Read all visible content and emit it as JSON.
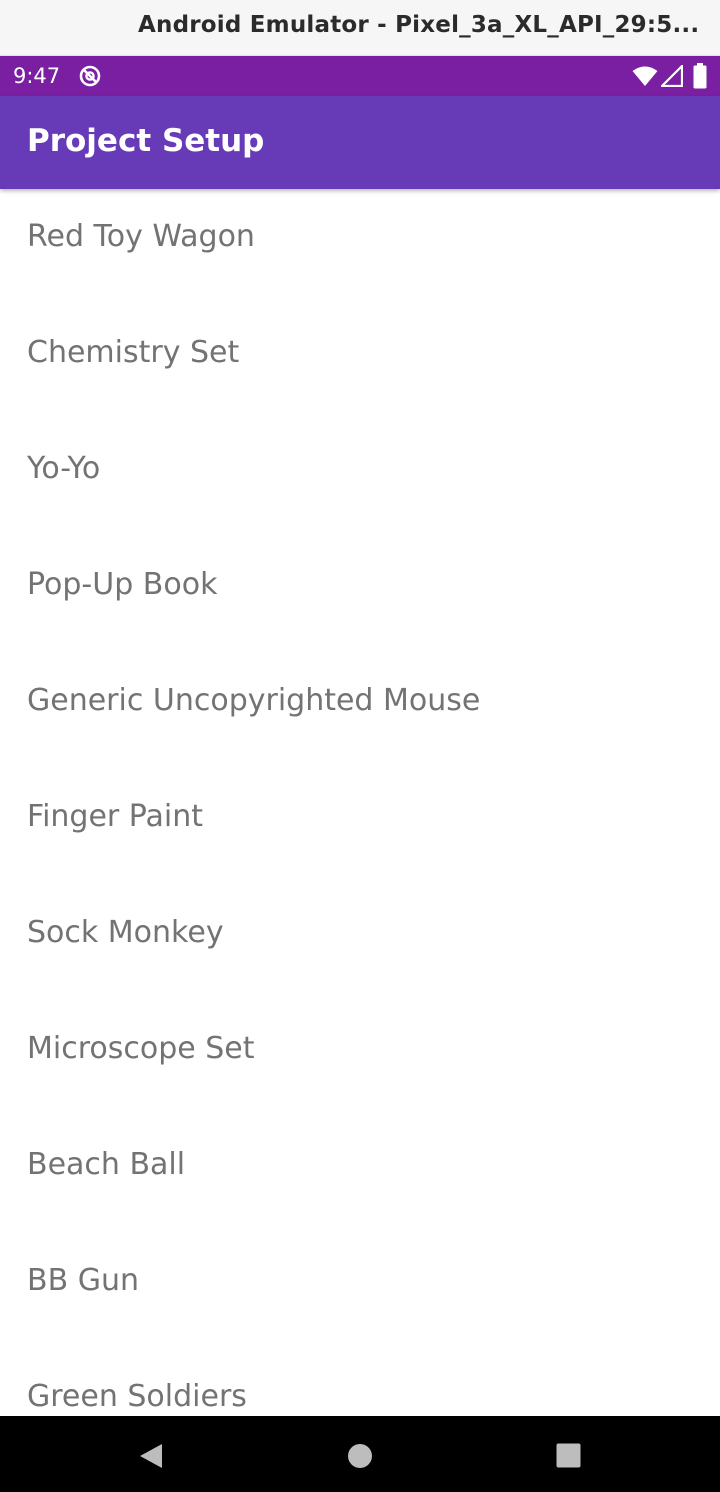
{
  "window": {
    "title": "Android Emulator - Pixel_3a_XL_API_29:5..."
  },
  "status_bar": {
    "time": "9:47",
    "color": "#7b1fa2",
    "icons": [
      "sync-icon",
      "wifi-icon",
      "cellular-signal-icon",
      "battery-icon"
    ]
  },
  "app_bar": {
    "title": "Project Setup",
    "color": "#673ab7"
  },
  "list": {
    "items": [
      {
        "label": "Red Toy Wagon"
      },
      {
        "label": "Chemistry Set"
      },
      {
        "label": "Yo-Yo"
      },
      {
        "label": "Pop-Up Book"
      },
      {
        "label": "Generic Uncopyrighted Mouse"
      },
      {
        "label": "Finger Paint"
      },
      {
        "label": "Sock Monkey"
      },
      {
        "label": "Microscope Set"
      },
      {
        "label": "Beach Ball"
      },
      {
        "label": "BB Gun"
      },
      {
        "label": "Green Soldiers"
      }
    ]
  },
  "nav_bar": {
    "icons": [
      "back-icon",
      "home-icon",
      "recents-icon"
    ]
  }
}
